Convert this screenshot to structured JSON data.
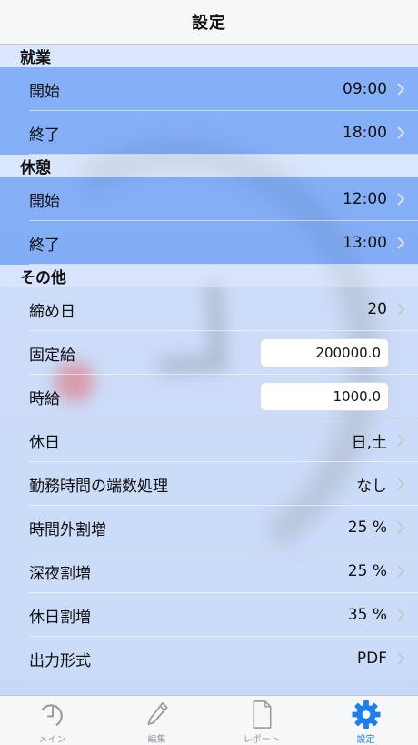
{
  "navbar": {
    "title": "設定"
  },
  "sections": {
    "work": {
      "header": "就業",
      "start": {
        "label": "開始",
        "value": "09:00"
      },
      "end": {
        "label": "終了",
        "value": "18:00"
      }
    },
    "rest": {
      "header": "休憩",
      "start": {
        "label": "開始",
        "value": "12:00"
      },
      "end": {
        "label": "終了",
        "value": "13:00"
      }
    },
    "other": {
      "header": "その他",
      "closing_day": {
        "label": "締め日",
        "value": "20"
      },
      "fixed_salary": {
        "label": "固定給",
        "value": "200000.0"
      },
      "hourly_wage": {
        "label": "時給",
        "value": "1000.0"
      },
      "holidays": {
        "label": "休日",
        "value": "日,土"
      },
      "rounding": {
        "label": "勤務時間の端数処理",
        "value": "なし"
      },
      "overtime": {
        "label": "時間外割増",
        "value": "25 %"
      },
      "night": {
        "label": "深夜割増",
        "value": "25 %"
      },
      "holiday_premium": {
        "label": "休日割増",
        "value": "35 %"
      },
      "output_format": {
        "label": "出力形式",
        "value": "PDF"
      }
    }
  },
  "tabbar": {
    "main": {
      "label": "メイン",
      "icon": "clock-icon"
    },
    "edit": {
      "label": "編集",
      "icon": "pencil-icon"
    },
    "report": {
      "label": "レポート",
      "icon": "document-icon"
    },
    "settings": {
      "label": "設定",
      "icon": "gear-icon"
    }
  },
  "colors": {
    "selected_row": "#6ea0f5",
    "accent": "#1c7ef0",
    "tab_inactive": "#9a9a9e"
  }
}
